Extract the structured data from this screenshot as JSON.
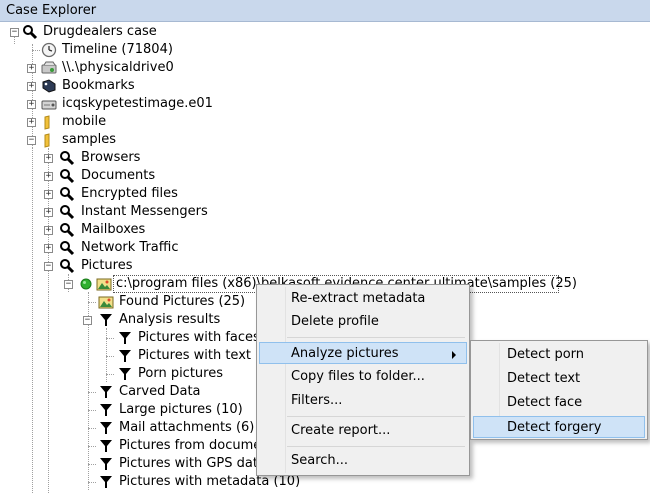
{
  "window": {
    "title": "Case Explorer"
  },
  "tree": {
    "items": [
      {
        "label": "Drugdealers case",
        "icon": "magnifier-icon"
      },
      {
        "label": "Timeline (71804)",
        "icon": "clock-icon"
      },
      {
        "label": "\\\\.\\physicaldrive0",
        "icon": "drive-icon"
      },
      {
        "label": "Bookmarks",
        "icon": "bookmark-icon"
      },
      {
        "label": "icqskypetestimage.e01",
        "icon": "disk-image-icon"
      },
      {
        "label": "mobile",
        "icon": "folder-icon"
      },
      {
        "label": "samples",
        "icon": "folder-icon"
      },
      {
        "label": "Browsers",
        "icon": "magnifier-icon"
      },
      {
        "label": "Documents",
        "icon": "magnifier-icon"
      },
      {
        "label": "Encrypted files",
        "icon": "magnifier-icon"
      },
      {
        "label": "Instant Messengers",
        "icon": "magnifier-icon"
      },
      {
        "label": "Mailboxes",
        "icon": "magnifier-icon"
      },
      {
        "label": "Network Traffic",
        "icon": "magnifier-icon"
      },
      {
        "label": "Pictures",
        "icon": "magnifier-icon"
      },
      {
        "label": "c:\\program files (x86)\\belkasoft evidence center ultimate\\samples (25)",
        "icon": "pictures-icon"
      },
      {
        "label": "Found Pictures (25)",
        "icon": "pictures-icon"
      },
      {
        "label": "Analysis results",
        "icon": "filter-icon"
      },
      {
        "label": "Pictures with faces",
        "icon": "filter-icon"
      },
      {
        "label": "Pictures with text",
        "icon": "filter-icon"
      },
      {
        "label": "Porn pictures",
        "icon": "filter-icon"
      },
      {
        "label": "Carved Data",
        "icon": "filter-icon"
      },
      {
        "label": "Large pictures (10)",
        "icon": "filter-icon"
      },
      {
        "label": "Mail attachments (6)",
        "icon": "filter-icon"
      },
      {
        "label": "Pictures from documents",
        "icon": "filter-icon"
      },
      {
        "label": "Pictures with GPS data",
        "icon": "filter-icon"
      },
      {
        "label": "Pictures with metadata (10)",
        "icon": "filter-icon"
      }
    ]
  },
  "context_menu": {
    "items": [
      {
        "label": "Re-extract metadata"
      },
      {
        "label": "Delete profile"
      },
      {
        "label": "Analyze pictures",
        "highlighted": true,
        "submenu": true
      },
      {
        "label": "Copy files to folder..."
      },
      {
        "label": "Filters..."
      },
      {
        "label": "Create report..."
      },
      {
        "label": "Search..."
      }
    ]
  },
  "submenu": {
    "items": [
      {
        "label": "Detect porn"
      },
      {
        "label": "Detect text"
      },
      {
        "label": "Detect face"
      },
      {
        "label": "Detect forgery",
        "highlighted": true
      }
    ]
  },
  "colors": {
    "title_bar": "#c9d8ec",
    "menu_highlight": "#cfe3f7",
    "menu_highlight_border": "#90c0ec",
    "status_green": "#2fb02f"
  }
}
